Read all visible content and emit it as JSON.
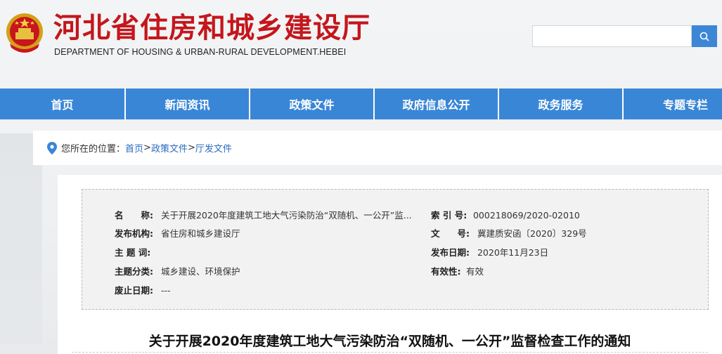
{
  "header": {
    "title": "河北省住房和城乡建设厅",
    "subtitle": "DEPARTMENT OF HOUSING & URBAN-RURAL DEVELOPMENT.HEBEI",
    "search": {
      "placeholder": "",
      "button_icon": "search-icon"
    },
    "emblem_icon": "national-emblem-icon"
  },
  "nav": {
    "items": [
      {
        "label": "首页"
      },
      {
        "label": "新闻资讯"
      },
      {
        "label": "政策文件"
      },
      {
        "label": "政府信息公开"
      },
      {
        "label": "政务服务"
      },
      {
        "label": "专题专栏"
      }
    ]
  },
  "breadcrumb": {
    "prefix": "您所在的位置：",
    "items": [
      "首页",
      "政策文件",
      "厅发文件"
    ],
    "sep": ">"
  },
  "meta": {
    "name_label": "名　　称:",
    "name_value": "关于开展2020年度建筑工地大气污染防治“双随机、一公开”监...",
    "index_label": "索 引 号:",
    "index_value": "000218069/2020-02010",
    "publisher_label": "发布机构:",
    "publisher_value": "省住房和城乡建设厅",
    "docno_label": "文　　号:",
    "docno_value": "冀建质安函〔2020〕329号",
    "subject_label": "主 题 词:",
    "subject_value": "",
    "date_label": "发布日期:",
    "date_value": "2020年11月23日",
    "category_label": "主题分类:",
    "category_value": "城乡建设、环境保护",
    "validity_label": "有效性:",
    "validity_value": "有效",
    "repeal_label": "废止日期:",
    "repeal_value": "---"
  },
  "document": {
    "title": "关于开展2020年度建筑工地大气污染防治“双随机、一公开”监督检查工作的通知"
  },
  "colors": {
    "brand_red": "#c4161c",
    "nav_blue": "#3a86d6",
    "link_blue": "#2a6bc0"
  }
}
